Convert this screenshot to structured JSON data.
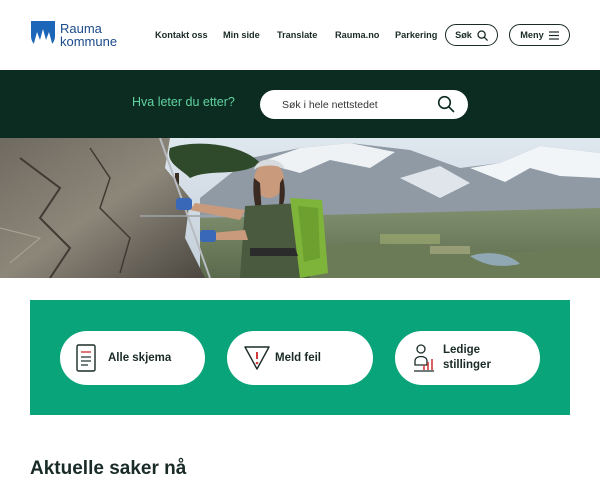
{
  "header": {
    "logo_line1": "Rauma",
    "logo_line2": "kommune",
    "nav": {
      "contact": "Kontakt oss",
      "my_page": "Min side",
      "translate": "Translate",
      "rauma_no": "Rauma.no",
      "parking": "Parkering"
    },
    "search_button": "Søk",
    "menu_button": "Meny"
  },
  "search": {
    "label": "Hva leter du etter?",
    "placeholder": "Søk i hele nettstedet"
  },
  "shortcuts": {
    "forms": "Alle skjema",
    "report": "Meld feil",
    "jobs_line1": "Ledige",
    "jobs_line2": "stillinger"
  },
  "news": {
    "title": "Aktuelle saker nå"
  },
  "colors": {
    "dark_green": "#0c2c22",
    "accent_green": "#0aa47a",
    "search_label": "#5fd3a0",
    "logo_blue": "#1b4a8a"
  }
}
